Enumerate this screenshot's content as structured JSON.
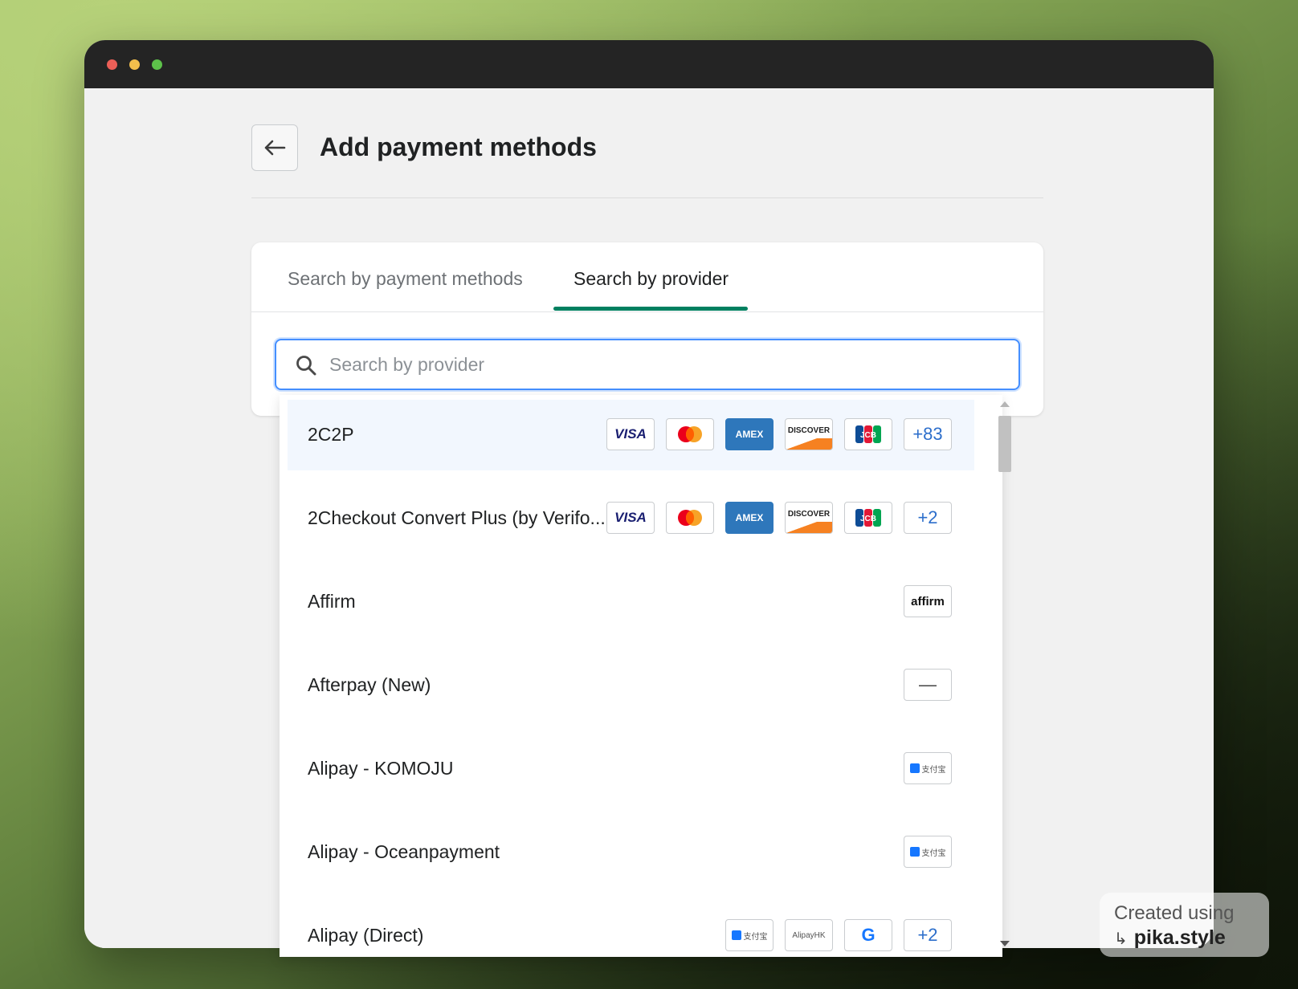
{
  "window": {
    "traffic_lights": [
      "close",
      "minimize",
      "zoom"
    ]
  },
  "header": {
    "title": "Add payment methods",
    "back_icon": "arrow-left-icon"
  },
  "tabs": [
    {
      "label": "Search by payment methods",
      "active": false
    },
    {
      "label": "Search by provider",
      "active": true
    }
  ],
  "search": {
    "placeholder": "Search by provider",
    "value": ""
  },
  "providers": [
    {
      "name": "2C2P",
      "selected": true,
      "logos": [
        "VISA",
        "mastercard",
        "AMEX",
        "DISCOVER",
        "JCB"
      ],
      "more": "+83"
    },
    {
      "name": "2Checkout Convert Plus (by Verifo...",
      "selected": false,
      "logos": [
        "VISA",
        "mastercard",
        "AMEX",
        "DISCOVER",
        "JCB"
      ],
      "more": "+2"
    },
    {
      "name": "Affirm",
      "selected": false,
      "logos": [
        "affirm"
      ]
    },
    {
      "name": "Afterpay (New)",
      "selected": false,
      "logos": [
        "—"
      ]
    },
    {
      "name": "Alipay - KOMOJU",
      "selected": false,
      "logos": [
        "支付宝"
      ]
    },
    {
      "name": "Alipay - Oceanpayment",
      "selected": false,
      "logos": [
        "支付宝"
      ]
    },
    {
      "name": "Alipay (Direct)",
      "selected": false,
      "logos": [
        "支付宝",
        "AlipayHK",
        "G"
      ],
      "more": "+2"
    }
  ],
  "watermark": {
    "line1": "Created using",
    "line2": "pika.style"
  },
  "colors": {
    "accent_tab": "#008060",
    "focus_border": "#458fff",
    "selected_row": "#f2f7fe",
    "amex_blue": "#2e77bb",
    "visa_blue": "#1a1f71"
  }
}
